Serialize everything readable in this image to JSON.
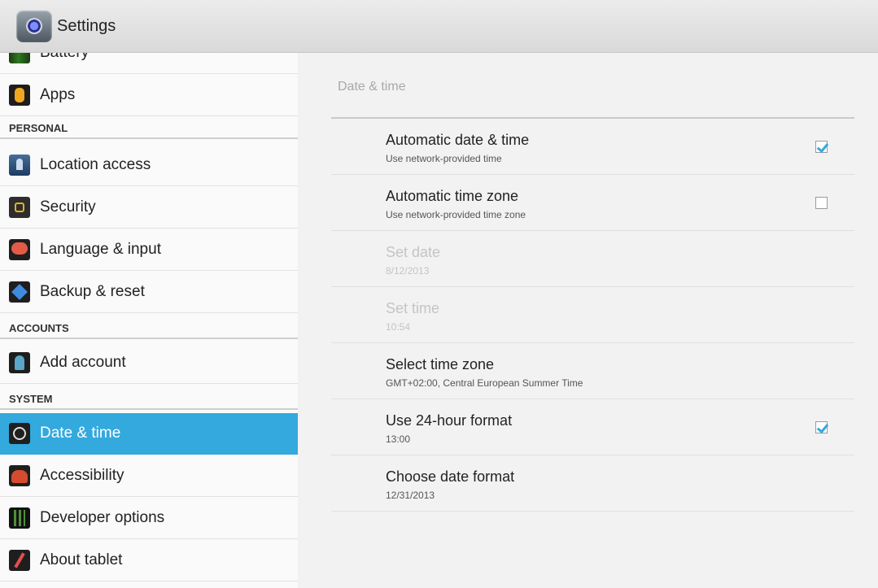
{
  "app": {
    "title": "Settings",
    "icon": "settings-gear-icon"
  },
  "sidebar": {
    "items": [
      {
        "label": "Battery",
        "icon": "battery-icon"
      },
      {
        "label": "Apps",
        "icon": "apps-icon"
      },
      {
        "label": "Location access",
        "icon": "location-icon"
      },
      {
        "label": "Security",
        "icon": "lock-icon"
      },
      {
        "label": "Language & input",
        "icon": "language-icon"
      },
      {
        "label": "Backup & reset",
        "icon": "backup-icon"
      },
      {
        "label": "Add account",
        "icon": "add-account-icon"
      },
      {
        "label": "Date & time",
        "icon": "clock-icon",
        "selected": true
      },
      {
        "label": "Accessibility",
        "icon": "accessibility-icon"
      },
      {
        "label": "Developer options",
        "icon": "developer-options-icon"
      },
      {
        "label": "About tablet",
        "icon": "about-tablet-icon"
      }
    ],
    "sections": {
      "personal": "PERSONAL",
      "accounts": "ACCOUNTS",
      "system": "SYSTEM"
    },
    "selected_color": "#33a9dd"
  },
  "main": {
    "title": "Date & time",
    "prefs": [
      {
        "title": "Automatic date & time",
        "summary": "Use network-provided time",
        "checkbox": true,
        "checked": true,
        "enabled": true
      },
      {
        "title": "Automatic time zone",
        "summary": "Use network-provided time zone",
        "checkbox": true,
        "checked": false,
        "enabled": true
      },
      {
        "title": "Set date",
        "summary": "8/12/2013",
        "enabled": false
      },
      {
        "title": "Set time",
        "summary": "10:54",
        "enabled": false
      },
      {
        "title": "Select time zone",
        "summary": "GMT+02:00, Central European Summer Time",
        "enabled": true
      },
      {
        "title": "Use 24-hour format",
        "summary": "13:00",
        "checkbox": true,
        "checked": true,
        "enabled": true
      },
      {
        "title": "Choose date format",
        "summary": "12/31/2013",
        "enabled": true
      }
    ]
  }
}
